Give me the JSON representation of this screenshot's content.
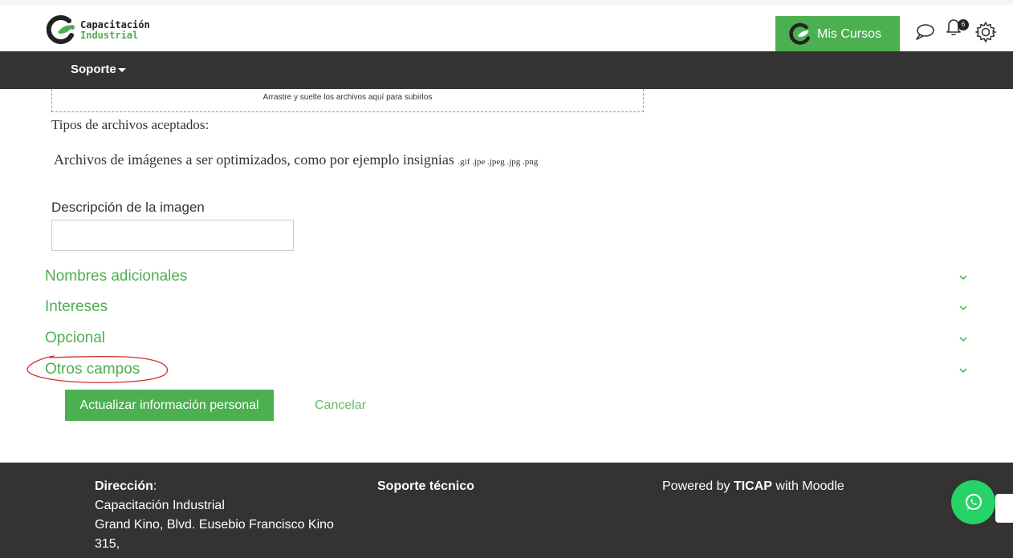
{
  "header": {
    "logo_line1": "Capacitación",
    "logo_line2": "Industrial",
    "mis_cursos_label": "Mis Cursos",
    "notification_count": "6",
    "icons": [
      "chat-icon",
      "bell-icon",
      "gear-icon"
    ]
  },
  "nav": {
    "soporte_label": "Soporte"
  },
  "form": {
    "dropzone_text": "Arrastre y suelte los archivos aquí para subirlos",
    "tipos_label": "Tipos de archivos aceptados:",
    "archivos_text": "Archivos de imágenes a ser optimizados, como por ejemplo insignias",
    "archivos_ext": ".gif .jpe .jpeg .jpg .png",
    "descripcion_label": "Descripción de la imagen",
    "descripcion_value": "",
    "sections": [
      {
        "label": "Nombres adicionales"
      },
      {
        "label": "Intereses"
      },
      {
        "label": "Opcional"
      },
      {
        "label": "Otros campos"
      }
    ],
    "submit_label": "Actualizar información personal",
    "cancel_label": "Cancelar"
  },
  "footer": {
    "direccion_label": "Dirección",
    "direccion_colon": ":",
    "direccion_lines": [
      "Capacitación Industrial",
      "Grand Kino, Blvd. Eusebio Francisco Kino",
      "315,"
    ],
    "soporte_label": "Soporte técnico",
    "powered_prefix": "Powered by",
    "powered_brand": "TICAP",
    "powered_suffix": "with Moodle"
  },
  "colors": {
    "accent": "#4caf50",
    "navbar": "#333333",
    "footer": "#333333",
    "whatsapp": "#25d366",
    "annotation": "#d32f2f"
  }
}
